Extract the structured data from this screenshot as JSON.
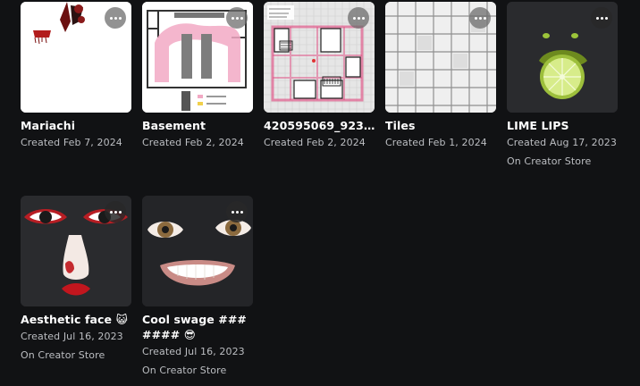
{
  "items": [
    {
      "title": "Mariachi",
      "created": "Created Feb 7, 2024",
      "store": ""
    },
    {
      "title": "Basement",
      "created": "Created Feb 2, 2024",
      "store": ""
    },
    {
      "title": "420595069_9233...",
      "created": "Created Feb 2, 2024",
      "store": ""
    },
    {
      "title": "Tiles",
      "created": "Created Feb 1, 2024",
      "store": ""
    },
    {
      "title": "LIME LIPS",
      "created": "Created Aug 17, 2023",
      "store": "On Creator Store"
    },
    {
      "title": "Aesthetic face 😺",
      "created": "Created Jul 16, 2023",
      "store": "On Creator Store"
    },
    {
      "title": "Cool swage ### #### 😎",
      "created": "Created Jul 16, 2023",
      "store": "On Creator Store"
    }
  ],
  "colors": {
    "background": "#111214",
    "meta_text": "#bcbec2",
    "thumb_bg": "#26272b"
  },
  "icons": {
    "more_button": "more-dots-icon"
  }
}
